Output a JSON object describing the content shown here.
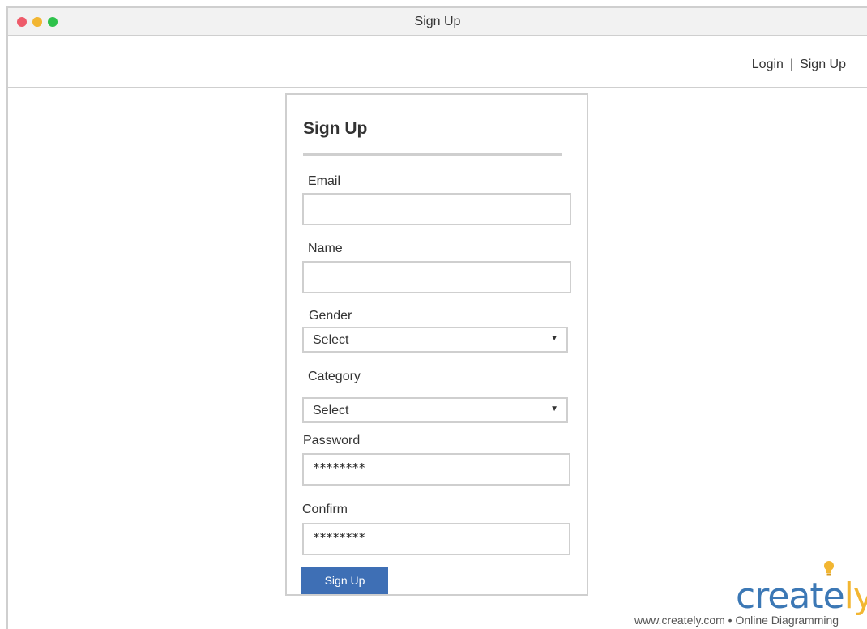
{
  "window": {
    "title": "Sign Up",
    "controls": [
      "close",
      "minimize",
      "maximize"
    ]
  },
  "nav": {
    "login": "Login",
    "separator": "|",
    "signup": "Sign Up"
  },
  "form": {
    "title": "Sign Up",
    "email_label": "Email",
    "email_value": "",
    "name_label": "Name",
    "name_value": "",
    "gender_label": "Gender",
    "gender_value": "Select",
    "category_label": "Category",
    "category_value": "Select",
    "password_label": "Password",
    "password_value": "********",
    "confirm_label": "Confirm",
    "confirm_value": "********",
    "submit_label": "Sign Up"
  },
  "watermark": {
    "logo_text_main": "create",
    "logo_text_end": "ly",
    "footer": "www.creately.com • Online Diagramming"
  },
  "colors": {
    "button": "#3e6fb5",
    "border": "#cfcfcf",
    "logo_blue": "#3c78b5",
    "logo_yellow": "#f2b632"
  }
}
